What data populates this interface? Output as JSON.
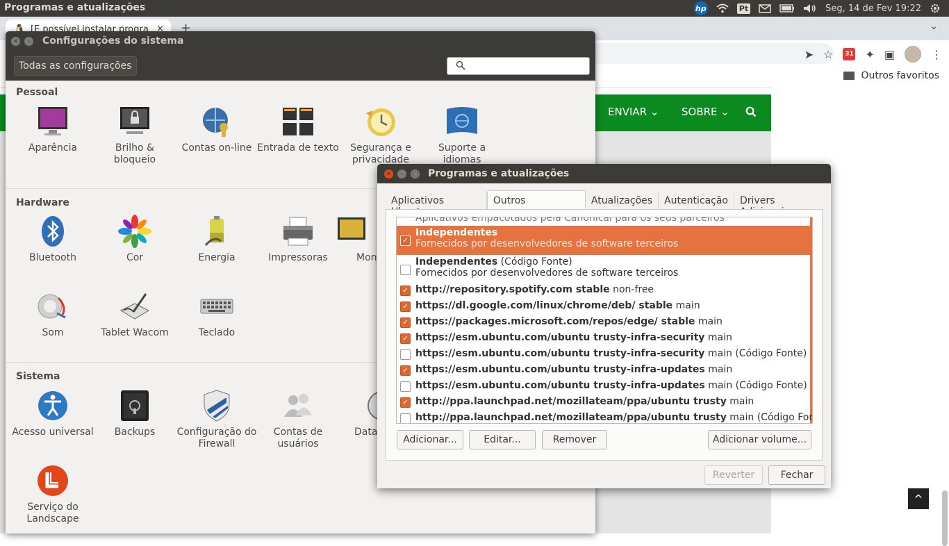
{
  "topbar": {
    "app_title": "Programas e atualizações",
    "hp_label": "hp",
    "keyboard_layout": "Pt",
    "clock": "Seg, 14 de Fev 19:22"
  },
  "browser": {
    "tab_title": "[É possível instalar progra",
    "tab_close": "×",
    "new_tab": "+",
    "calendar_badge": "31",
    "bookmarks_other": "Outros favoritos",
    "nav": {
      "enviar": "ENVIAR ⌄",
      "sobre": "SOBRE ⌄"
    },
    "scroll_top": "^"
  },
  "settings": {
    "title": "Configurações do sistema",
    "all_settings": "Todas as configurações",
    "search_placeholder": "",
    "sections": {
      "pessoal": "Pessoal",
      "hardware": "Hardware",
      "sistema": "Sistema"
    },
    "pessoal": [
      "Aparência",
      "Brilho & bloqueio",
      "Contas on-line",
      "Entrada de texto",
      "Segurança e privacidade",
      "Suporte a idiomas"
    ],
    "hardware": [
      "Bluetooth",
      "Cor",
      "Energia",
      "Impressoras",
      "Mon",
      "Som",
      "Tablet Wacom",
      "Teclado"
    ],
    "sistema": [
      "Acesso universal",
      "Backups",
      "Configuração do Firewall",
      "Contas de usuários",
      "Data",
      "Serviço do Landscape"
    ]
  },
  "software": {
    "title": "Programas e atualizações",
    "tabs": [
      "Aplicativos Ubuntu",
      "Outros programas",
      "Atualizações",
      "Autenticação",
      "Drivers Adicionais"
    ],
    "partial_row": "Aplicativos empacotados pela Canonical para os seus parceiros",
    "rows": [
      {
        "bold": "Independentes",
        "rest": "",
        "sub": "Fornecidos por desenvolvedores de software terceiros",
        "checked": true
      },
      {
        "bold": "Independentes",
        "rest": " (Código Fonte)",
        "sub": "Fornecidos por desenvolvedores de software terceiros",
        "checked": false
      },
      {
        "bold": "http://repository.spotify.com stable",
        "rest": " non-free",
        "checked": true
      },
      {
        "bold": "https://dl.google.com/linux/chrome/deb/ stable",
        "rest": " main",
        "checked": true
      },
      {
        "bold": "https://packages.microsoft.com/repos/edge/ stable",
        "rest": " main",
        "checked": true
      },
      {
        "bold": "https://esm.ubuntu.com/ubuntu trusty-infra-security",
        "rest": " main",
        "checked": true
      },
      {
        "bold": "https://esm.ubuntu.com/ubuntu trusty-infra-security",
        "rest": " main (Código Fonte)",
        "checked": false
      },
      {
        "bold": "https://esm.ubuntu.com/ubuntu trusty-infra-updates",
        "rest": " main",
        "checked": true
      },
      {
        "bold": "https://esm.ubuntu.com/ubuntu trusty-infra-updates",
        "rest": " main (Código Fonte)",
        "checked": false
      },
      {
        "bold": "http://ppa.launchpad.net/mozillateam/ppa/ubuntu trusty",
        "rest": " main",
        "checked": true
      },
      {
        "bold": "http://ppa.launchpad.net/mozillateam/ppa/ubuntu trusty",
        "rest": " main (Código Fonte)",
        "checked": false
      }
    ],
    "buttons": {
      "add": "Adicionar...",
      "edit": "Editar...",
      "remove": "Remover",
      "add_volume": "Adicionar volume...",
      "revert": "Reverter",
      "close": "Fechar"
    }
  },
  "colors": {
    "ubuntu_orange": "#e5733f",
    "panel_dark": "#3c3b37",
    "site_green": "#0b8b1f"
  }
}
